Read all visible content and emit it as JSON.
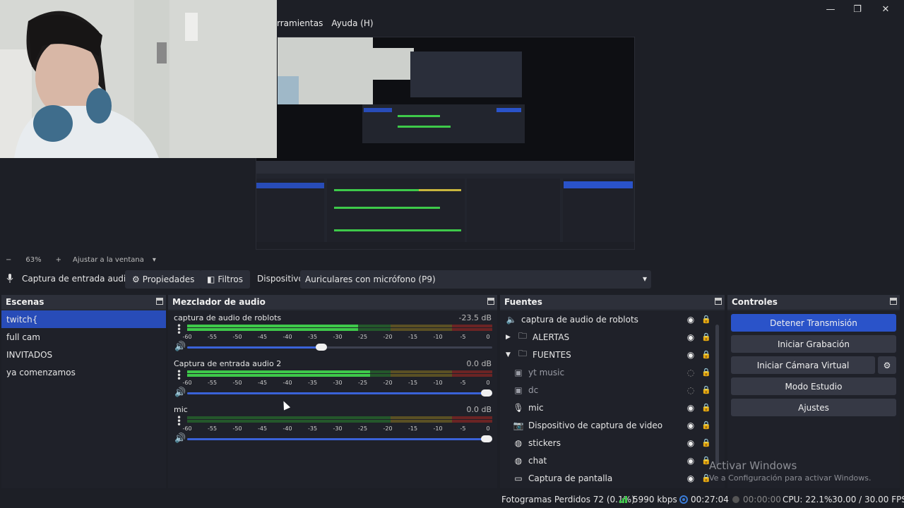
{
  "window": {
    "minimize": "—",
    "maximize": "❐",
    "close": "✕"
  },
  "menu": {
    "items": [
      "rramientas",
      "Ayuda (H)"
    ]
  },
  "zoom": {
    "minus": "−",
    "value": "63%",
    "plus": "+",
    "fit_label": "Ajustar a la ventana",
    "chevron": "▾"
  },
  "context": {
    "source_label": "Captura de entrada audio :",
    "properties_label": "Propiedades",
    "filters_label": "Filtros",
    "device_label": "Dispositivo",
    "device_value": "Auriculares con micrófono (P9)"
  },
  "scenes": {
    "title": "Escenas",
    "items": [
      "twitch{",
      "full cam",
      "INVITADOS",
      "ya comenzamos"
    ]
  },
  "mixer": {
    "title": "Mezclador de audio",
    "ticks": [
      "-60",
      "-55",
      "-50",
      "-45",
      "-40",
      "-35",
      "-30",
      "-25",
      "-20",
      "-15",
      "-10",
      "-5",
      "0"
    ],
    "channels": [
      {
        "name": "captura de audio de roblots",
        "db": "-23.5 dB",
        "level": 0.56,
        "volume": 0.44
      },
      {
        "name": "Captura de entrada audio 2",
        "db": "0.0 dB",
        "level": 0.6,
        "volume": 1.0
      },
      {
        "name": "mic",
        "db": "0.0 dB",
        "level": 0.0,
        "volume": 1.0
      }
    ]
  },
  "sources": {
    "title": "Fuentes",
    "items": [
      {
        "name": "captura de audio de roblots",
        "icon": "speaker-icon"
      },
      {
        "name": "ALERTAS",
        "icon": "folder-icon"
      },
      {
        "name": "FUENTES",
        "icon": "folder-icon"
      },
      {
        "name": "yt music",
        "icon": "window-icon"
      },
      {
        "name": "dc",
        "icon": "window-icon"
      },
      {
        "name": "mic",
        "icon": "mic-icon"
      },
      {
        "name": "Dispositivo de captura de video",
        "icon": "camera-icon"
      },
      {
        "name": "stickers",
        "icon": "browser-icon"
      },
      {
        "name": "chat",
        "icon": "browser-icon"
      },
      {
        "name": "Captura de pantalla",
        "icon": "monitor-icon"
      }
    ]
  },
  "controls": {
    "title": "Controles",
    "stop_stream": "Detener Transmisión",
    "start_recording": "Iniciar Grabación",
    "start_virtual_cam": "Iniciar Cámara Virtual",
    "studio_mode": "Modo Estudio",
    "settings": "Ajustes"
  },
  "status": {
    "dropped_frames": "Fotogramas Perdidos 72 (0.1%)",
    "bitrate": "5990 kbps",
    "stream_time": "00:27:04",
    "rec_time": "00:00:00",
    "cpu": "CPU: 22.1%",
    "fps": "30.00 / 30.00 FPS"
  },
  "watermark": {
    "title": "Activar Windows",
    "subtitle": "Ve a Configuración para activar Windows."
  },
  "colors": {
    "accent": "#2a53c9",
    "selected": "#284cb8",
    "meter_green": "#3ec94a",
    "meter_yellow": "#c9b63e",
    "meter_red": "#c93e3e"
  }
}
